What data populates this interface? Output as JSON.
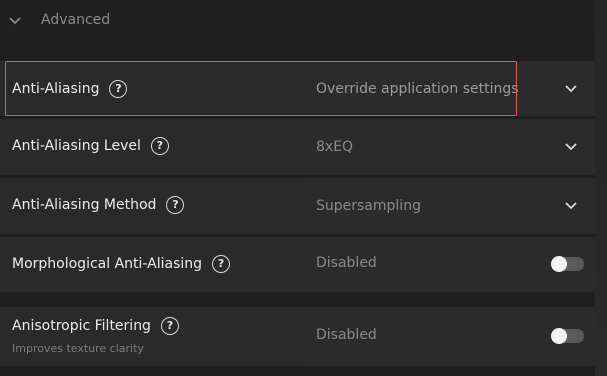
{
  "section": {
    "title": "Advanced"
  },
  "settings": [
    {
      "label": "Anti-Aliasing",
      "value": "Override application settings",
      "control": "dropdown"
    },
    {
      "label": "Anti-Aliasing Level",
      "value": "8xEQ",
      "control": "dropdown"
    },
    {
      "label": "Anti-Aliasing Method",
      "value": "Supersampling",
      "control": "dropdown"
    },
    {
      "label": "Morphological Anti-Aliasing",
      "value": "Disabled",
      "control": "toggle",
      "on": false
    },
    {
      "label": "Anisotropic Filtering",
      "description": "Improves texture clarity",
      "value": "Disabled",
      "control": "toggle",
      "on": false
    }
  ],
  "icons": {
    "help": "?",
    "help_name": "help-circle-icon",
    "dropdown": "chevron-down-icon"
  },
  "colors": {
    "highlight": "#e05a5a",
    "background": "#1f1f1f",
    "row": "#2a2a2a"
  }
}
